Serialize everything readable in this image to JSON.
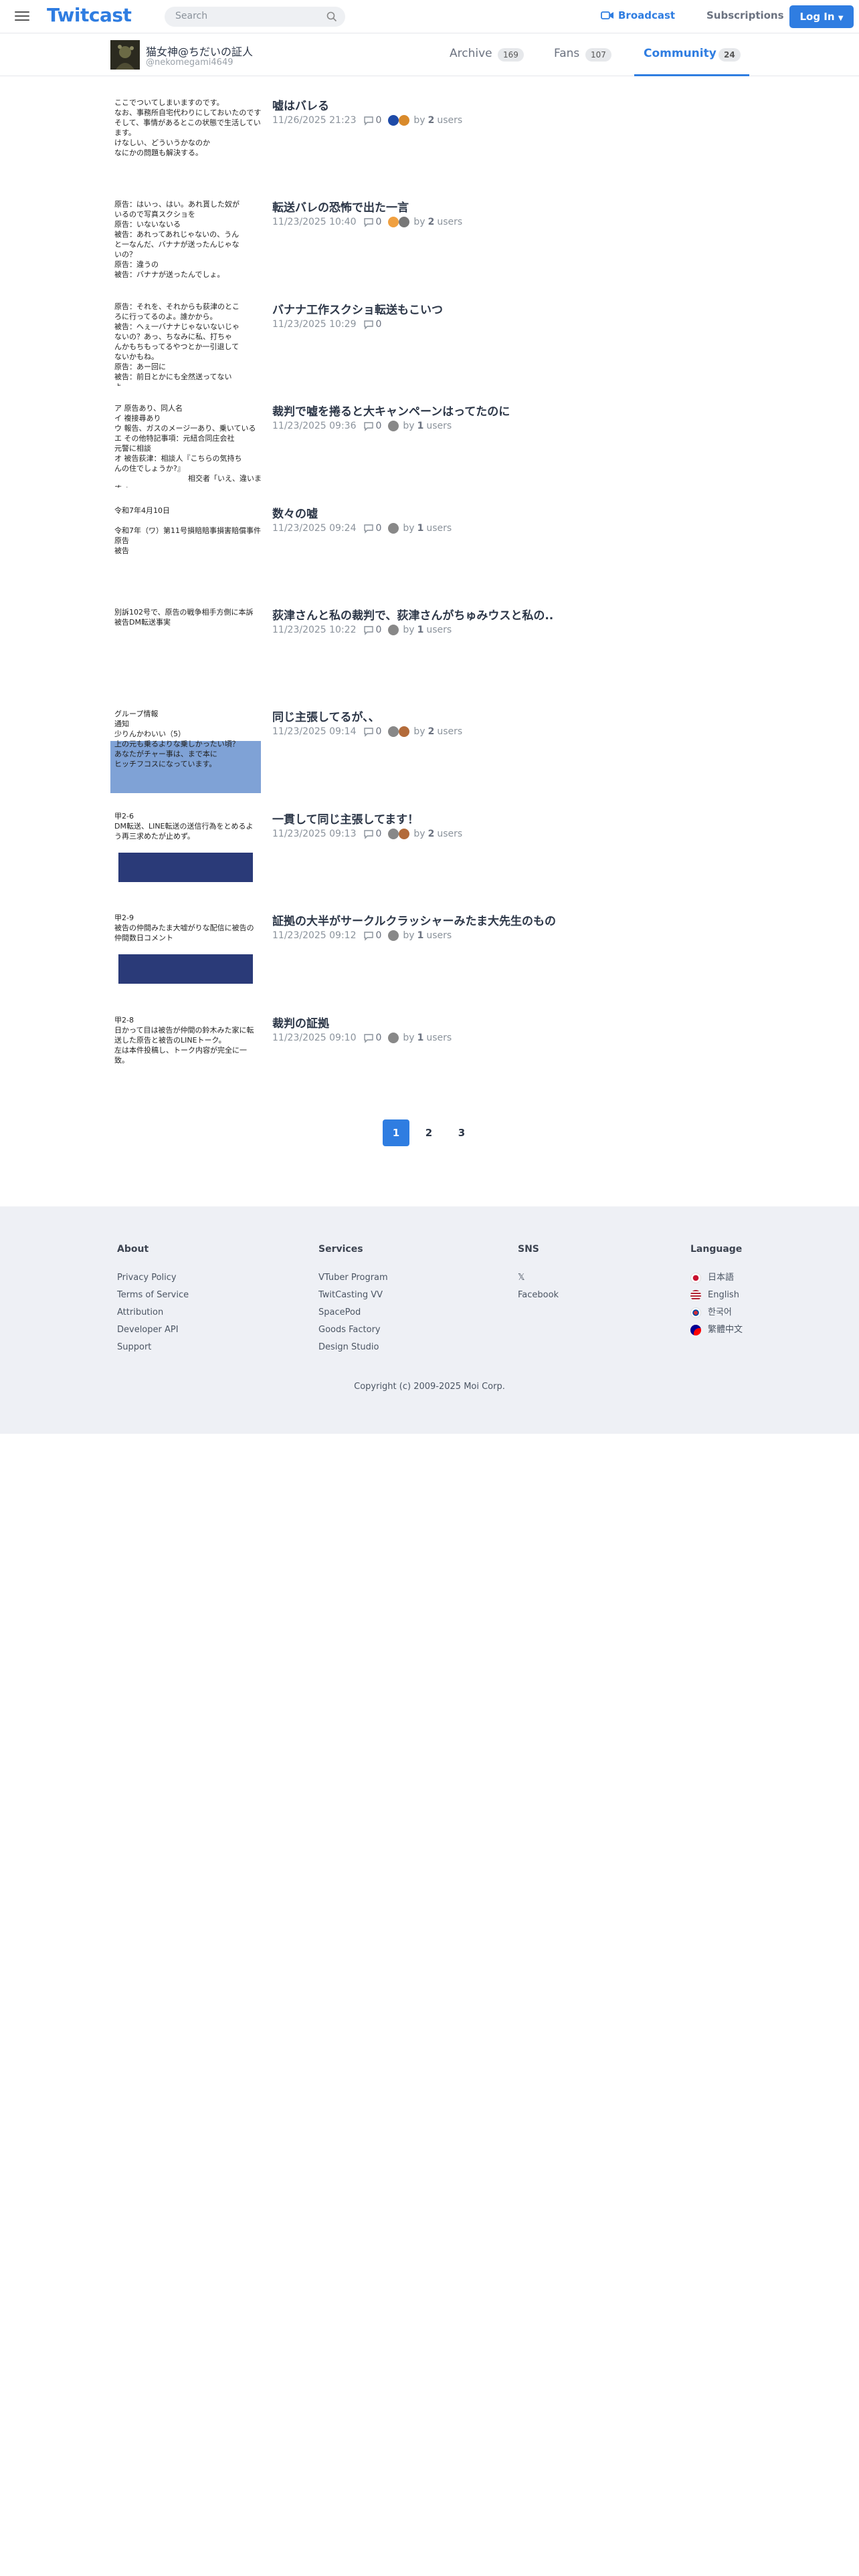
{
  "header": {
    "logo": "Twitcast",
    "search_placeholder": "Search",
    "broadcast_label": "Broadcast",
    "subscriptions_label": "Subscriptions",
    "login_label": "Log In"
  },
  "user": {
    "name": "猫女神@ちだいの証人",
    "id": "@nekomegami4649"
  },
  "tabs": [
    {
      "label": "Archive",
      "count": "169",
      "active": false
    },
    {
      "label": "Fans",
      "count": "107",
      "active": false
    },
    {
      "label": "Community",
      "count": "24",
      "active": true
    }
  ],
  "posts": [
    {
      "title": "嘘はバレる",
      "date": "11/26/2025 21:23",
      "comments": "0",
      "users": "2",
      "by_prefix": "by",
      "by_suffix": "users",
      "thumb_text": [
        "ここでついてしまいますのです。",
        "なお、事務所自宅代わりにしておいたのです、",
        "そして、事情があるとこの状態で生活してい",
        "ます。",
        "けなしい、どういうかなのか",
        "なにかの問題も解決する。"
      ]
    },
    {
      "title": "転送バレの恐怖で出た一言",
      "date": "11/23/2025 10:40",
      "comments": "0",
      "users": "2",
      "by_prefix": "by",
      "by_suffix": "users",
      "thumb_text": [
        "原告：はいっ、はい。あれ貰した奴が",
        "いるので写真スクショを",
        "原告：いないないる",
        "被告：あれってあれじゃないの、うん",
        "と一なんだ、バナナが送ったんじゃな",
        "いの？",
        "原告：違うの",
        "被告：バナナが送ったんでしょ。"
      ]
    },
    {
      "title": "バナナ工作スクショ転送もこいつ",
      "date": "11/23/2025 10:29",
      "comments": "0",
      "users": "",
      "by_prefix": "",
      "by_suffix": "",
      "thumb_text": [
        "原告：それを、それからも荻津のとこ",
        "ろに行ってるのよ。誰かから。",
        "被告：へぇ一バナナじゃないないじゃ",
        "ないの？あっ、ちなみに私、打ちゃ",
        "んかもちもってるやつとか一引退して",
        "ないかもね。",
        "原告：あー回に",
        "被告：前日とかにも全然送ってない",
        "よ。"
      ]
    },
    {
      "title": "裁判で嘘を捲ると大キャンペーンはってたのに",
      "date": "11/23/2025 09:36",
      "comments": "0",
      "users": "1",
      "by_prefix": "by",
      "by_suffix": "users",
      "thumb_text": [
        "ア 原告あり、同人名",
        "イ 複接尋あり",
        "ウ 報告、ガスのメージ一あり、乗いている",
        "エ その他特記事項：元紐合同庄会社",
        "元警に相談",
        "オ 被告荻津：相談人『こちらの気持ち",
        "んの住でしょうか?』",
        "　　　　　　　　　　相交者「いえ、違いま",
        "す。」"
      ]
    },
    {
      "title": "数々の嘘",
      "date": "11/23/2025 09:24",
      "comments": "0",
      "users": "1",
      "by_prefix": "by",
      "by_suffix": "users",
      "thumb_text": [
        "令和7年4月10日",
        "",
        "令和7年（ワ）第11号損賠賠事損害賠償事件",
        "原告",
        "被告"
      ]
    },
    {
      "title": "荻津さんと私の裁判で、荻津さんがちゅみウスと私の..",
      "date": "11/23/2025 10:22",
      "comments": "0",
      "users": "1",
      "by_prefix": "by",
      "by_suffix": "users",
      "thumb_text": [
        "別訴102号で、原告の戦争相手方側に本訴",
        "被告DM転送事実"
      ]
    },
    {
      "title": "同じ主張してるが、、",
      "date": "11/23/2025 09:14",
      "comments": "0",
      "users": "2",
      "by_prefix": "by",
      "by_suffix": "users",
      "thumb_text": [
        "グループ情報",
        "通知",
        "少りんかわいい（5）",
        "上の元も乗るよりな乗しかったい頃？",
        "あなたがチャー事は、まで本に",
        "ヒッチフコスになっています。"
      ]
    },
    {
      "title": "一貫して同じ主張してます！",
      "date": "11/23/2025 09:13",
      "comments": "0",
      "users": "2",
      "by_prefix": "by",
      "by_suffix": "users",
      "thumb_text": [
        "甲2-6",
        "DM転送、LINE転送の送信行為をとめるよ",
        "う再三求めたが止めず。"
      ]
    },
    {
      "title": "証拠の大半がサークルクラッシャーみたま大先生のもの",
      "date": "11/23/2025 09:12",
      "comments": "0",
      "users": "1",
      "by_prefix": "by",
      "by_suffix": "users",
      "thumb_text": [
        "甲2-9",
        "被告の仲間みたま大嘘がりな配信に被告の",
        "仲間数日コメント"
      ]
    },
    {
      "title": "裁判の証拠",
      "date": "11/23/2025 09:10",
      "comments": "0",
      "users": "1",
      "by_prefix": "by",
      "by_suffix": "users",
      "thumb_text": [
        "甲2-8",
        "日かって目は被告が仲間の鈴木みた家に転",
        "送した原告と被告のLINEトーク。",
        "左は本件投稿し、トーク内容が完全に一",
        "致。"
      ]
    }
  ],
  "pagination": [
    "1",
    "2",
    "3"
  ],
  "footer": {
    "columns": [
      {
        "title": "About",
        "links": [
          "Privacy Policy",
          "Terms of Service",
          "Attribution",
          "Developer API",
          "Support"
        ]
      },
      {
        "title": "Services",
        "links": [
          "VTuber Program",
          "TwitCasting VV",
          "SpacePod",
          "Goods Factory",
          "Design Studio"
        ]
      },
      {
        "title": "SNS",
        "links": [
          "𝕏",
          "Facebook"
        ]
      },
      {
        "title": "Language",
        "links": [
          "日本語",
          "English",
          "한국어",
          "繁體中文"
        ]
      }
    ],
    "copyright": "Copyright (c) 2009-2025 Moi Corp."
  },
  "colors": {
    "accent": "#2f7de1",
    "footer_bg": "#eef0f5"
  }
}
